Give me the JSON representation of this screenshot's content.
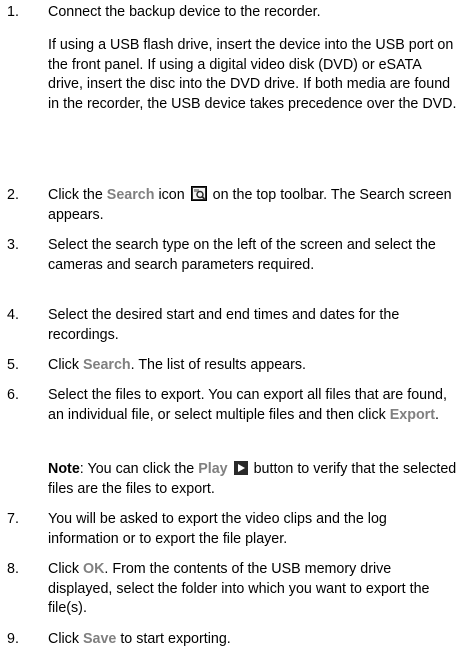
{
  "steps": [
    {
      "number": "1.",
      "text": "Connect the backup device to the recorder.",
      "sub": "If using a USB flash drive, insert the device into the USB port on the front panel. If using a digital video disk (DVD) or eSATA drive, insert the disc into the DVD drive. If both media are found in the recorder, the USB device takes precedence over the DVD."
    },
    {
      "number": "2.",
      "pre": " Click the ",
      "link": "Search",
      "mid": " icon",
      "post": " on the top toolbar. The Search screen appears.",
      "icon": "search-toolbar-icon"
    },
    {
      "number": "3.",
      "text": "Select the search type on the left of the screen and select the cameras and search parameters required."
    },
    {
      "number": "4.",
      "text": "Select the desired start and end times and dates for the recordings."
    },
    {
      "number": "5.",
      "pre": "Click ",
      "link": "Search",
      "post": ". The list of results appears."
    },
    {
      "number": "6.",
      "pre": "Select the files to export. You can export all files that are found, an individual file, or select multiple files and then click ",
      "link": "Export",
      "post": ".",
      "note_label": "Note",
      "note_pre": ": You can click the ",
      "note_link": "Play",
      "note_post": " button to verify that the selected files are the files to export.",
      "note_icon": "play-icon"
    },
    {
      "number": "7.",
      "text": "You will be asked to export the video clips and the log information or to export the file player."
    },
    {
      "number": "8.",
      "pre": "Click ",
      "link": "OK",
      "post": ". From the contents of the USB memory drive displayed, select the folder into which you want to export the file(s)."
    },
    {
      "number": "9.",
      "pre": "Click ",
      "link": "Save",
      "post": " to start exporting."
    }
  ]
}
